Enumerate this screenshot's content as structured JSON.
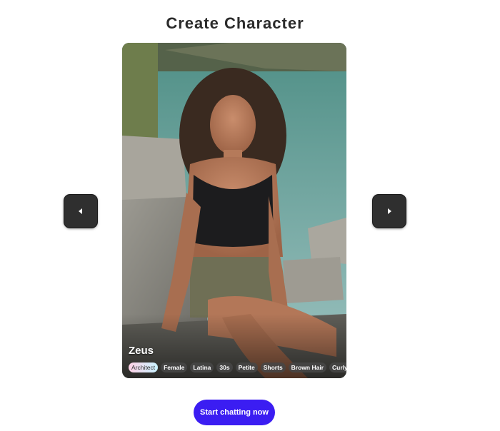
{
  "header": {
    "title": "Create Character"
  },
  "carousel": {
    "prev_icon": "caret-left-icon",
    "next_icon": "caret-right-icon",
    "card": {
      "name": "Zeus",
      "tags": [
        "Architect",
        "Female",
        "Latina",
        "30s",
        "Petite",
        "Shorts",
        "Brown Hair",
        "Curly Ha"
      ],
      "highlighted_tag_index": 0
    }
  },
  "actions": {
    "start_label": "Start chatting now"
  },
  "colors": {
    "primary": "#3b1df2",
    "nav_button": "#2f2f2f",
    "title": "#2b2b2b"
  }
}
